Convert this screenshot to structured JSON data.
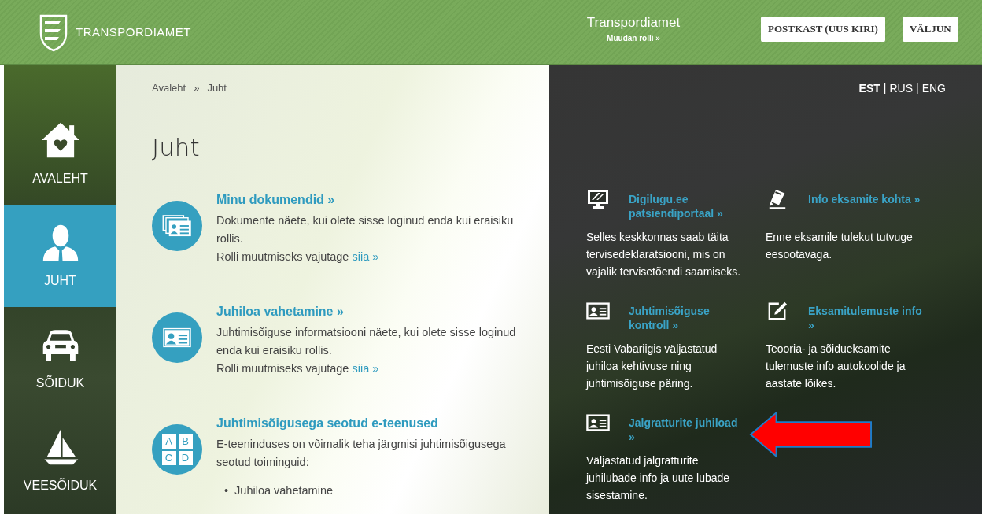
{
  "header": {
    "logo_text": "TRANSPORDIAMET",
    "role_title": "Transpordiamet",
    "role_link": "Muudan rolli »",
    "buttons": [
      "POSTKAST (UUS KIRI)",
      "VÄLJUN"
    ]
  },
  "sidebar": {
    "items": [
      {
        "kind": "home",
        "label": "AVALEHT",
        "selected": false
      },
      {
        "kind": "person",
        "label": "JUHT",
        "selected": true
      },
      {
        "kind": "car",
        "label": "SÕIDUK",
        "selected": false
      },
      {
        "kind": "boat",
        "label": "VEESÕIDUK",
        "selected": false
      }
    ]
  },
  "breadcrumb": [
    "Avaleht",
    "Juht"
  ],
  "breadcrumb_separator": "»",
  "page_title": "Juht",
  "services": [
    {
      "kind": "cards",
      "title": "Minu dokumendid »",
      "description": "Dokumente näete, kui olete sisse loginud enda kui eraisiku rollis.",
      "role_note": "Rolli muutmiseks vajutage",
      "role_link": "siia »"
    },
    {
      "kind": "card",
      "title": "Juhiloa vahetamine »",
      "description": "Juhtimisõiguse informatsiooni näete, kui olete sisse loginud enda kui eraisiku rollis.",
      "role_note": "Rolli muutmiseks vajutage",
      "role_link": "siia »"
    },
    {
      "kind": "abc",
      "letters": [
        "A",
        "B",
        "C",
        "D"
      ],
      "title": "Juhtimisõigusega seotud e-teenused",
      "description": "E-teeninduses on võimalik teha järgmisi juhtimisõigusega seotud toiminguid:",
      "bullets": [
        "Juhiloa vahetamine"
      ]
    }
  ],
  "language_separator": "|",
  "bullet_marker": "•",
  "languages": [
    {
      "label": "EST",
      "selected": true
    },
    {
      "label": "RUS",
      "selected": false
    },
    {
      "label": "ENG",
      "selected": false
    }
  ],
  "tiles": [
    {
      "kind": "monitor",
      "title": "Digilugu.ee patsiendiportaal »",
      "description": "Selles keskkonnas saab täita tervisedeklaratsiooni, mis on vajalik tervisetõendi saamiseks."
    },
    {
      "kind": "pen",
      "title": "Info eksamite kohta »",
      "description": "Enne eksamile tulekut tutvuge eesootavaga."
    },
    {
      "kind": "card",
      "title": "Juhtimisõiguse kontroll »",
      "description": "Eesti Vabariigis väljastatud juhiloa kehtivuse ning juhtimisõiguse päring."
    },
    {
      "kind": "edit",
      "title": "Eksamitulemuste info »",
      "description": "Teooria- ja sõidueksamite tulemuste info autokoolide ja aastate lõikes."
    },
    {
      "kind": "card",
      "title": "Jalgratturite juhiload »",
      "description": "Väljastatud jalgratturite juhilubade info ja uute lubade sisestamine."
    }
  ]
}
